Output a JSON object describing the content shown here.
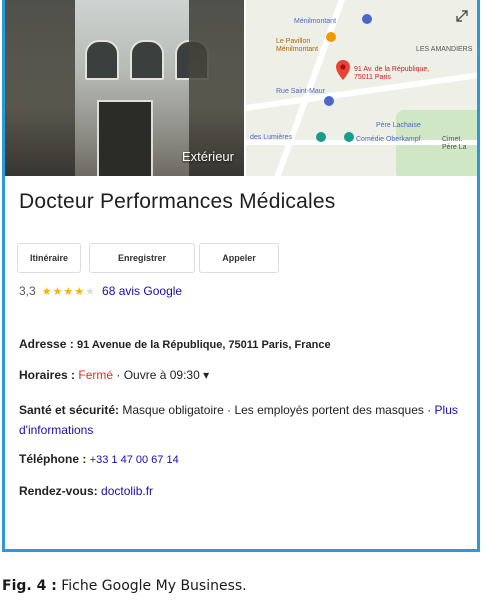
{
  "photo": {
    "overlay_label": "Extérieur"
  },
  "map": {
    "labels": [
      "Ménilmontant",
      "Le Pavillon Ménilmontant",
      "91 Av. de la République, 75011 Paris",
      "Rue Saint-Maur",
      "des Lumières",
      "Comédie Oberkampf",
      "Père Lachaise",
      "LES AMANDIERS",
      "Cimet. Père La"
    ],
    "pin_color": "#ea4335",
    "icons": [
      "expand-icon",
      "map-pin-icon"
    ]
  },
  "business": {
    "name": "Docteur Performances Médicales"
  },
  "actions": [
    "Itinéraire",
    "Enregistrer",
    "Appeler"
  ],
  "rating": {
    "score": "3,3",
    "stars": 3.3,
    "reviews": "68 avis Google"
  },
  "info": {
    "address_label": "Adresse :",
    "address_value": "91 Avenue de la République, 75011 Paris, France",
    "hours_label": "Horaires :",
    "hours_status": "Fermé",
    "hours_rest": " · Ouvre à 09:30 ▾",
    "safety_label": "Santé et sécurité:",
    "safety_value": " Masque obligatoire · Les employés portent des masques · ",
    "safety_link": "Plus d'informations",
    "phone_label": "Téléphone :",
    "phone_value": "+33 1 47 00 67 14",
    "booking_label": "Rendez-vous:",
    "booking_value": "doctolib.fr"
  },
  "caption": {
    "prefix": "Fig. 4 :",
    "text": " Fiche Google My Business."
  }
}
